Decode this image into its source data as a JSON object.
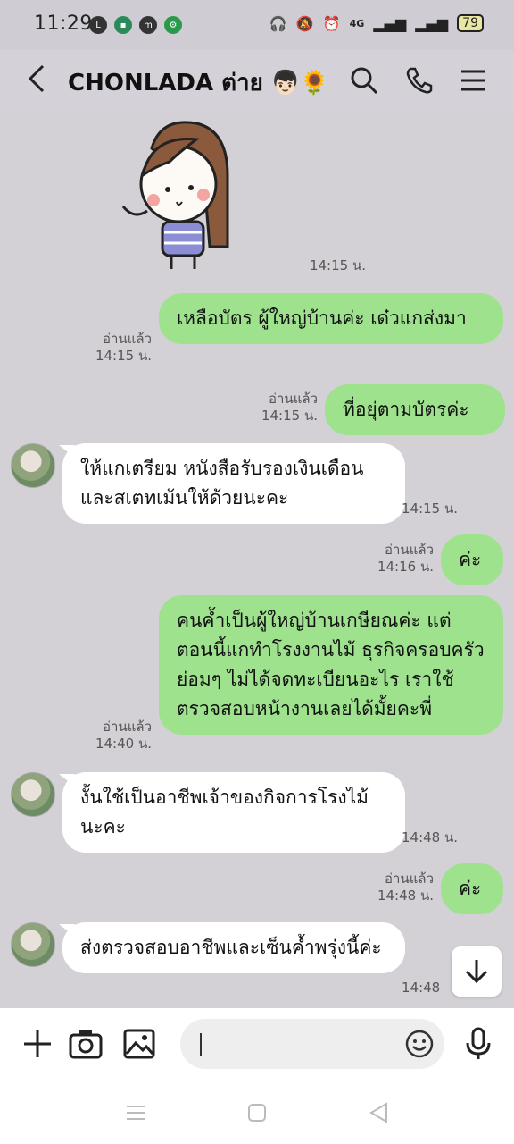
{
  "status": {
    "time": "11:29",
    "network": "4G",
    "battery": "79"
  },
  "header": {
    "title": "CHONLADA ต่าย 👦🏻🌻"
  },
  "messages": [
    {
      "dir": "in",
      "type": "sticker",
      "time": "14:15 น."
    },
    {
      "dir": "out",
      "text": "เหลือบัตร ผู้ใหญ่บ้านค่ะ เด๋วแกส่งมา",
      "read": "อ่านแล้ว",
      "time": "14:15 น."
    },
    {
      "dir": "out",
      "text": "ที่อยุ่ตามบัตรค่ะ",
      "read": "อ่านแล้ว",
      "time": "14:15 น."
    },
    {
      "dir": "in",
      "text": "ให้แกเตรียม หนังสือรับรองเงินเดือนและสเตทเม้นให้ด้วยนะคะ",
      "time": "14:15 น."
    },
    {
      "dir": "out",
      "text": "ค่ะ",
      "read": "อ่านแล้ว",
      "time": "14:16 น."
    },
    {
      "dir": "out",
      "text": "คนค้ำเป็นผู้ใหญ่บ้านเกษียณค่ะ แต่ตอนนี้แกทำโรงงานไม้ ธุรกิจครอบครัว ย่อมๆ ไม่ได้จดทะเบียนอะไร เราใช้ตรวจสอบหน้างานเลยได้มั้ยคะพี่",
      "read": "อ่านแล้ว",
      "time": "14:40 น."
    },
    {
      "dir": "in",
      "text": "งั้นใช้เป็นอาชีพเจ้าของกิจการโรงไม้นะคะ",
      "time": "14:48 น."
    },
    {
      "dir": "out",
      "text": "ค่ะ",
      "read": "อ่านแล้ว",
      "time": "14:48 น."
    },
    {
      "dir": "in",
      "text": "ส่งตรวจสอบอาชีพและเซ็นค้ำพรุ่งนี้ค่ะ",
      "time": "14:48"
    }
  ],
  "colors": {
    "outgoing": "#9ee28e",
    "incoming": "#ffffff",
    "background": "#d3d1d6"
  }
}
